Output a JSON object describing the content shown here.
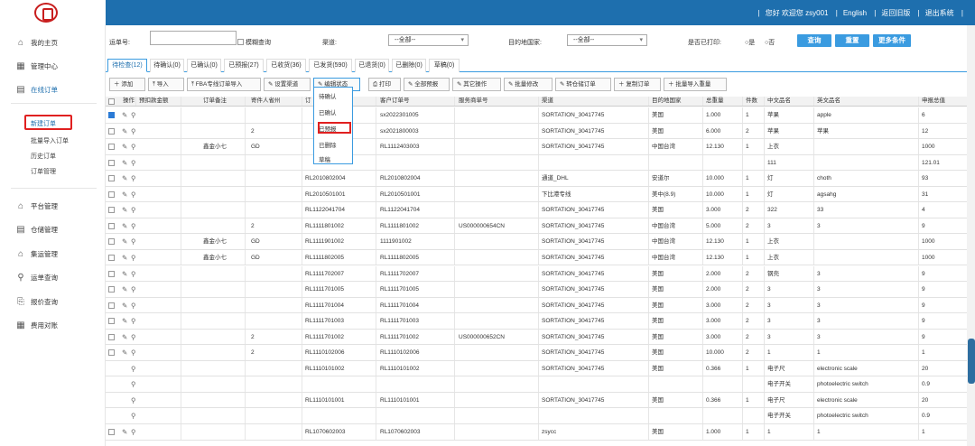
{
  "header": {
    "links": [
      "您好 欢迎您 zsy001",
      "English",
      "返回旧版",
      "退出系统"
    ]
  },
  "sidebar": {
    "items": [
      {
        "label": "我的主页",
        "icon": "home-icon",
        "glyph": "⌂"
      },
      {
        "label": "管理中心",
        "icon": "grid-icon",
        "glyph": "▦"
      },
      {
        "label": "在线订单",
        "icon": "document-icon",
        "glyph": "▤"
      },
      {
        "label": "平台管理",
        "icon": "platform-icon",
        "glyph": "⌂"
      },
      {
        "label": "仓储管理",
        "icon": "warehouse-icon",
        "glyph": "▤"
      },
      {
        "label": "集运管理",
        "icon": "consolidation-icon",
        "glyph": "⌂"
      },
      {
        "label": "运单查询",
        "icon": "search-icon",
        "glyph": "⚲"
      },
      {
        "label": "报价查询",
        "icon": "price-query-icon",
        "glyph": "⎘"
      },
      {
        "label": "费用对账",
        "icon": "calendar-icon",
        "glyph": "▦"
      }
    ],
    "subitems": [
      "新建订单",
      "批量导入订单",
      "历史订单",
      "订单管理"
    ]
  },
  "filters": {
    "order_no_label": "运单号:",
    "fuzzy_label": "模糊查询",
    "channel_label": "渠道:",
    "channel_value": "--全部--",
    "dest_label": "目的地国家:",
    "dest_value": "--全部--",
    "printed_label": "是否已打印:",
    "yes": "是",
    "no": "否",
    "query_btn": "查询",
    "reset_btn": "重置",
    "more_btn": "更多条件"
  },
  "tabs": [
    "待检查(12)",
    "待确认(0)",
    "已确认(0)",
    "已预报(27)",
    "已收货(36)",
    "已发货(590)",
    "已退货(0)",
    "已删除(0)",
    "草稿(0)"
  ],
  "toolbar": [
    "添加",
    "导入",
    "FBA专线订单导入",
    "设置渠道",
    "编辑状态",
    "打印",
    "全部预报",
    "其它操作",
    "批量修改",
    "转仓储订单",
    "复制订单",
    "批量导入重量"
  ],
  "dropdown": [
    "待确认",
    "已确认",
    "已预报",
    "已删除",
    "草稿"
  ],
  "table": {
    "headers": [
      "操作",
      "预扣款金额",
      "订单备注",
      "寄件人省州",
      "订",
      "客户订单号",
      "服务商单号",
      "渠道",
      "目的地国家",
      "总重量",
      "件数",
      "中文品名",
      "英文品名",
      "申报总值"
    ],
    "rows": [
      [
        "",
        "",
        "",
        "",
        "sx2022301005",
        "",
        "SORTATION_30417745",
        "美国",
        "1.000",
        "1",
        "苹果",
        "apple",
        "6"
      ],
      [
        "",
        "",
        "2",
        "",
        "sx2021800003",
        "",
        "SORTATION_30417745",
        "美国",
        "6.000",
        "2",
        "苹果",
        "苹果",
        "12"
      ],
      [
        "",
        "鑫金小七",
        "GD",
        "",
        "RL1112403003",
        "",
        "SORTATION_30417745",
        "中国台湾",
        "12.130",
        "1",
        "上衣",
        "",
        "1000"
      ],
      [
        "",
        "",
        "",
        "",
        "",
        "",
        "",
        "",
        "",
        "",
        "111",
        "",
        "121.01"
      ],
      [
        "",
        "",
        "",
        "RL2010802004",
        "RL2010802004",
        "",
        "通道_DHL",
        "安道尔",
        "10.000",
        "1",
        "灯",
        "choth",
        "93"
      ],
      [
        "",
        "",
        "",
        "RL2010501001",
        "RL2010501001",
        "",
        "下比港专线",
        "美中(8.9)",
        "10.000",
        "1",
        "灯",
        "agsahg",
        "31"
      ],
      [
        "",
        "",
        "",
        "RL1122041704",
        "RL1122041704",
        "",
        "SORTATION_30417745",
        "美国",
        "3.000",
        "2",
        "322",
        "33",
        "4"
      ],
      [
        "",
        "",
        "2",
        "RL1111801002",
        "RL1111801002",
        "US000000654CN",
        "SORTATION_30417745",
        "中国台湾",
        "5.000",
        "2",
        "3",
        "3",
        "9"
      ],
      [
        "",
        "鑫金小七",
        "GD",
        "RL1111901002",
        "1111901002",
        "",
        "SORTATION_30417745",
        "中国台湾",
        "12.130",
        "1",
        "上衣",
        "",
        "1000"
      ],
      [
        "",
        "鑫金小七",
        "GD",
        "RL1111802005",
        "RL1111802005",
        "",
        "SORTATION_30417745",
        "中国台湾",
        "12.130",
        "1",
        "上衣",
        "",
        "1000"
      ],
      [
        "",
        "",
        "",
        "RL1111702007",
        "RL1111702007",
        "",
        "SORTATION_30417745",
        "美国",
        "2.000",
        "2",
        "钢壳",
        "3",
        "9"
      ],
      [
        "",
        "",
        "",
        "RL1111701005",
        "RL1111701005",
        "",
        "SORTATION_30417745",
        "美国",
        "2.000",
        "2",
        "3",
        "3",
        "9"
      ],
      [
        "",
        "",
        "",
        "RL1111701004",
        "RL1111701004",
        "",
        "SORTATION_30417745",
        "美国",
        "3.000",
        "2",
        "3",
        "3",
        "9"
      ],
      [
        "",
        "",
        "",
        "RL1111701003",
        "RL1111701003",
        "",
        "SORTATION_30417745",
        "美国",
        "3.000",
        "2",
        "3",
        "3",
        "9"
      ],
      [
        "",
        "",
        "2",
        "RL1111701002",
        "RL1111701002",
        "US000000652CN",
        "SORTATION_30417745",
        "美国",
        "3.000",
        "2",
        "3",
        "3",
        "9"
      ],
      [
        "",
        "",
        "2",
        "RL1110102006",
        "RL1110102006",
        "",
        "SORTATION_30417745",
        "美国",
        "10.000",
        "2",
        "1",
        "1",
        "1"
      ],
      [
        "",
        "",
        "",
        "RL1110101002",
        "RL1110101002",
        "",
        "SORTATION_30417745",
        "美国",
        "0.366",
        "1",
        "电子尺",
        "electronic scale",
        "20"
      ],
      [
        "",
        "",
        "",
        "",
        "",
        "",
        "",
        "",
        "",
        "",
        "电子开关",
        "photoelectric switch",
        "0.9"
      ],
      [
        "",
        "",
        "",
        "RL1110101001",
        "RL1110101001",
        "",
        "SORTATION_30417745",
        "美国",
        "0.366",
        "1",
        "电子尺",
        "electronic scale",
        "20"
      ],
      [
        "",
        "",
        "",
        "",
        "",
        "",
        "",
        "",
        "",
        "",
        "电子开关",
        "photoelectric switch",
        "0.9"
      ],
      [
        "",
        "",
        "",
        "RL1070602003",
        "RL1070602003",
        "",
        "zsycc",
        "美国",
        "1.000",
        "1",
        "1",
        "1",
        "1"
      ]
    ],
    "row_kinds": [
      "full",
      "full",
      "full",
      "blank",
      "full",
      "full",
      "full",
      "full",
      "full",
      "full",
      "full",
      "full",
      "full",
      "full",
      "full",
      "full",
      "search",
      "searchblank",
      "search",
      "searchblank",
      "full"
    ]
  }
}
